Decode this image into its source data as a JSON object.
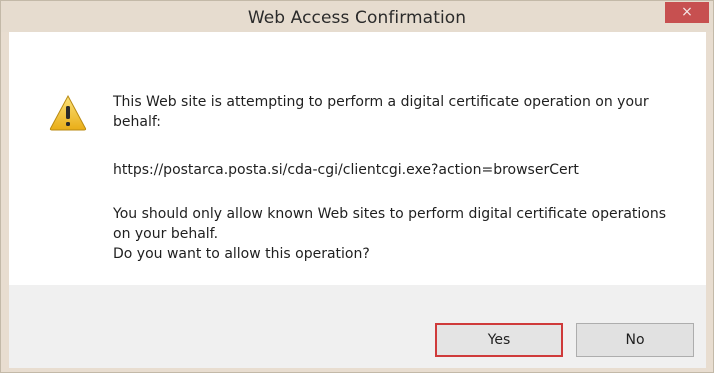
{
  "window": {
    "title": "Web Access Confirmation",
    "close_glyph": "×"
  },
  "icons": {
    "warning": "warning-triangle-icon",
    "close": "close-icon"
  },
  "message": {
    "line1": "This Web site is attempting to perform a digital certificate operation on your behalf:",
    "url": "https://postarca.posta.si/cda-cgi/clientcgi.exe?action=browserCert",
    "line3a": "You should only allow known Web sites to perform digital certificate operations on your behalf.",
    "line3b": "Do you want to allow this operation?"
  },
  "buttons": {
    "yes": "Yes",
    "no": "No"
  },
  "colors": {
    "titlebar": "#e6dccf",
    "close_button": "#c75050",
    "default_button_border": "#cf3a3a",
    "warning_fill": "#f2c12e"
  }
}
